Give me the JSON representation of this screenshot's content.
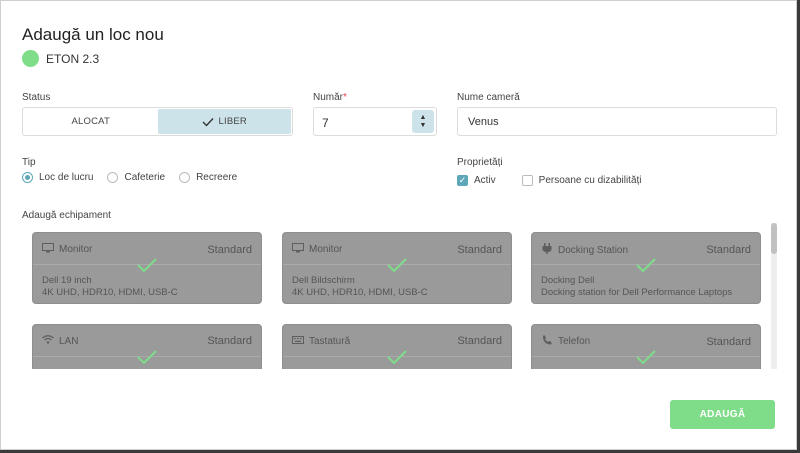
{
  "dialog": {
    "title": "Adaugă un loc nou"
  },
  "building": {
    "name": "ETON 2.3",
    "color": "#7fdd8a"
  },
  "status": {
    "label": "Status",
    "options": [
      "ALOCAT",
      "LIBER"
    ],
    "selected": "LIBER"
  },
  "number": {
    "label": "Număr",
    "required_mark": "*",
    "value": "7"
  },
  "room": {
    "label": "Nume cameră",
    "value": "Venus"
  },
  "type": {
    "label": "Tip",
    "options": [
      "Loc de lucru",
      "Cafeterie",
      "Recreere"
    ],
    "selected": "Loc de lucru"
  },
  "properties": {
    "label": "Proprietăți",
    "active": {
      "label": "Activ",
      "checked": true
    },
    "disability": {
      "label": "Persoane cu dizabilități",
      "checked": false
    }
  },
  "equipment": {
    "label": "Adaugă echipament",
    "cards": [
      {
        "icon": "monitor-icon",
        "name": "Monitor",
        "level": "Standard",
        "line1": "Dell 19 inch",
        "line2": "4K UHD, HDR10, HDMI, USB-C"
      },
      {
        "icon": "monitor-icon",
        "name": "Monitor",
        "level": "Standard",
        "line1": "Dell Bildschirm",
        "line2": "4K UHD, HDR10, HDMI, USB-C"
      },
      {
        "icon": "docking-icon",
        "name": "Docking Station",
        "level": "Standard",
        "line1": "Docking Dell",
        "line2": "Docking station for Dell Performance Laptops"
      },
      {
        "icon": "wifi-icon",
        "name": "LAN",
        "level": "Standard",
        "line1": "",
        "line2": ""
      },
      {
        "icon": "keyboard-icon",
        "name": "Tastatură",
        "level": "Standard",
        "line1": "",
        "line2": ""
      },
      {
        "icon": "phone-icon",
        "name": "Telefon",
        "level": "Standard",
        "line1": "",
        "line2": ""
      }
    ]
  },
  "actions": {
    "submit": "ADAUGĂ"
  }
}
